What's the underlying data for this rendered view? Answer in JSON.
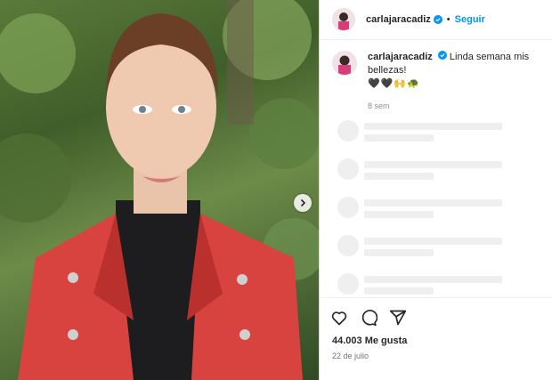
{
  "user": {
    "username": "carlajaracadiz",
    "verified": true,
    "follow_label": "Seguir",
    "separator": "•"
  },
  "caption": {
    "username": "carlajaracadiz",
    "text": "Linda semana mis bellezas!",
    "emojis": "🖤🖤🙌🐢",
    "time": "8 sem"
  },
  "stats": {
    "likes": "44.003 Me gusta",
    "date": "22 de julio"
  },
  "icons": [
    "like-icon",
    "comment-icon",
    "share-icon",
    "chevron-right-icon",
    "verified-badge-icon"
  ],
  "colors": {
    "accent": "#0095f6",
    "skeleton": "#efefef",
    "jacket": "#d9433f"
  }
}
